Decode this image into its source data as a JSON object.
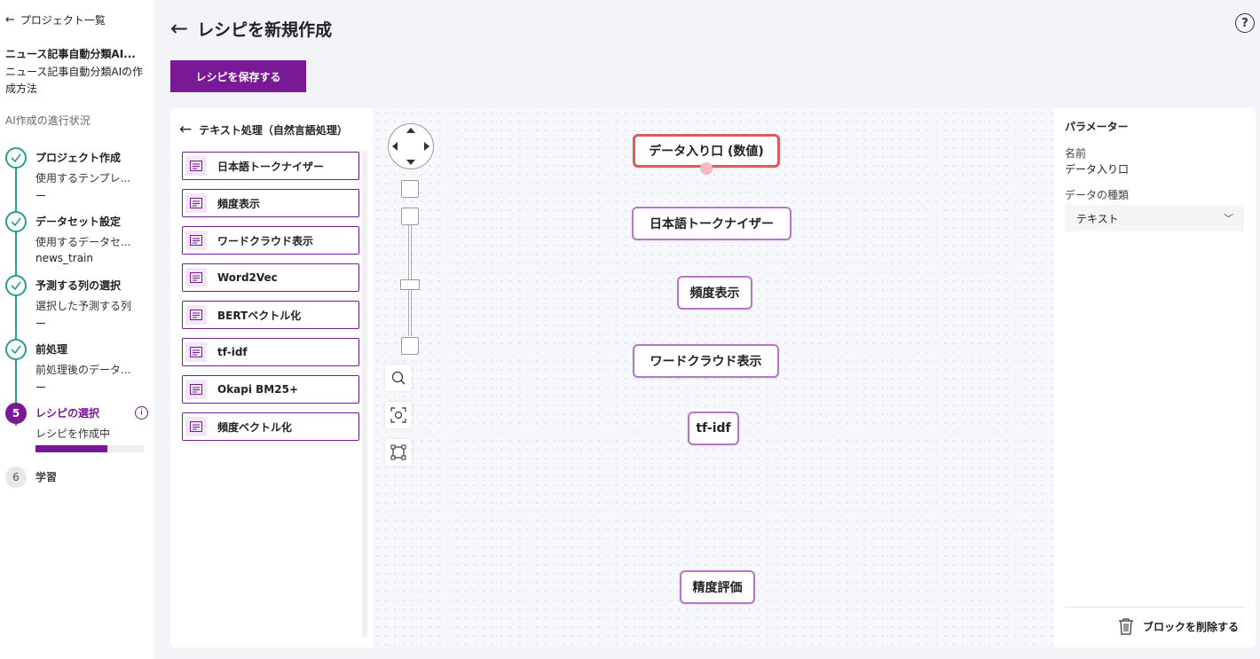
{
  "sidebar": {
    "back_label": "プロジェクト一覧",
    "project_name": "ニュース記事自動分類AI...",
    "project_desc": "ニュース記事自動分類AIの作成方法",
    "progress_title": "AI作成の進行状況",
    "steps": [
      {
        "title": "プロジェクト作成",
        "sub": "使用するテンプレ...",
        "value": "ー"
      },
      {
        "title": "データセット設定",
        "sub": "使用するデータセ...",
        "value": "news_train"
      },
      {
        "title": "予測する列の選択",
        "sub": "選択した予測する列",
        "value": "ー"
      },
      {
        "title": "前処理",
        "sub": "前処理後のデータ...",
        "value": "ー"
      },
      {
        "number": "5",
        "title": "レシピの選択",
        "sub": "レシピを作成中",
        "info": "i",
        "progress": 0.66
      },
      {
        "number": "6",
        "title": "学習"
      }
    ]
  },
  "header": {
    "title": "レシピを新規作成",
    "save_label": "レシピを保存する",
    "help": "?"
  },
  "palette": {
    "title": "テキスト処理（自然言語処理）",
    "items": [
      "日本語トークナイザー",
      "頻度表示",
      "ワードクラウド表示",
      "Word2Vec",
      "BERTベクトル化",
      "tf-idf",
      "Okapi BM25+",
      "頻度ベクトル化"
    ]
  },
  "canvas": {
    "nodes": [
      "データ入り口 (数値)",
      "日本語トークナイザー",
      "頻度表示",
      "ワードクラウド表示",
      "tf-idf",
      "精度評価"
    ]
  },
  "params": {
    "title": "パラメーター",
    "name_label": "名前",
    "name_value": "データ入り口",
    "type_label": "データの種類",
    "type_value": "テキスト",
    "delete_label": "ブロックを削除する"
  },
  "colors": {
    "accent": "#7a1996",
    "done": "#2a9d8f",
    "selected_node": "#e05a5a"
  }
}
